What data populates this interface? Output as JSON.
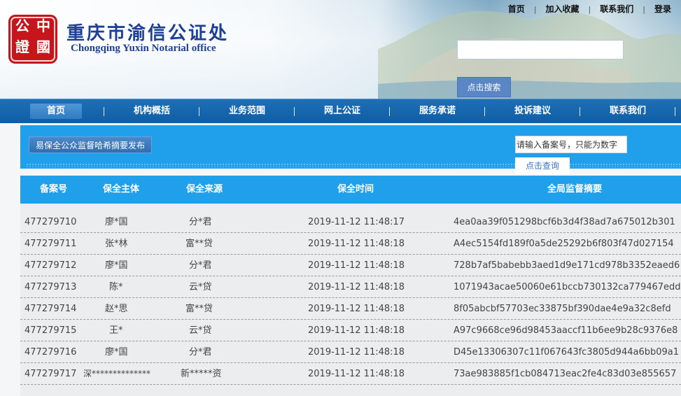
{
  "header": {
    "seal_text": [
      "中",
      "國",
      "公",
      "證"
    ],
    "brand_cn": "重庆市渝信公证处",
    "brand_en": "Chongqing Yuxin Notarial office",
    "top_links": [
      "首页",
      "加入收藏",
      "联系我们",
      "登录"
    ],
    "top_separator": "|",
    "search_value": "",
    "search_button": "点击搜索"
  },
  "nav": {
    "items": [
      "首页",
      "机构概括",
      "业务范围",
      "网上公证",
      "服务承诺",
      "投诉建议",
      "联系我们"
    ],
    "active_index": 0
  },
  "banner": {
    "publish_button": "易保全公众监督哈希摘要发布",
    "case_input_placeholder": "请输入备案号，只能为数字",
    "query_button": "点击查询"
  },
  "table": {
    "columns": [
      "备案号",
      "保全主体",
      "保全来源",
      "保全时间",
      "全局监督摘要"
    ],
    "rows": [
      {
        "id": "477279710",
        "subject": "廖*国",
        "source": "分*君",
        "time": "2019-11-12 11:48:17",
        "digest": "4ea0aa39f051298bcf6b3d4f38ad7a675012b301"
      },
      {
        "id": "477279711",
        "subject": "张*林",
        "source": "富**贷",
        "time": "2019-11-12 11:48:18",
        "digest": "A4ec5154fd189f0a5de25292b6f803f47d027154"
      },
      {
        "id": "477279712",
        "subject": "廖*国",
        "source": "分*君",
        "time": "2019-11-12 11:48:18",
        "digest": "728b7af5babebb3aed1d9e171cd978b3352eaed6"
      },
      {
        "id": "477279713",
        "subject": "陈*",
        "source": "云*贷",
        "time": "2019-11-12 11:48:18",
        "digest": "1071943acae50060e61bccb730132ca779467edd"
      },
      {
        "id": "477279714",
        "subject": "赵*思",
        "source": "富**贷",
        "time": "2019-11-12 11:48:18",
        "digest": "8f05abcbf57703ec33875bf390dae4e9a32c8efd"
      },
      {
        "id": "477279715",
        "subject": "王*",
        "source": "云*贷",
        "time": "2019-11-12 11:48:18",
        "digest": "A97c9668ce96d98453aaccf11b6ee9b28c9376e8"
      },
      {
        "id": "477279716",
        "subject": "廖*国",
        "source": "分*君",
        "time": "2019-11-12 11:48:18",
        "digest": "D45e13306307c11f067643fc3805d944a6bb09a1"
      },
      {
        "id": "477279717",
        "subject": "深**************",
        "source": "新*****资",
        "time": "2019-11-12 11:48:18",
        "digest": "73ae983885f1cb084713eac2fe4c83d03e855657"
      }
    ]
  },
  "colors": {
    "nav_blue": "#0f5ea5",
    "banner_blue": "#20a0ea",
    "brand_blue": "#1d3f94",
    "seal_red": "#c7161b",
    "button_blue": "#5a86c6"
  }
}
